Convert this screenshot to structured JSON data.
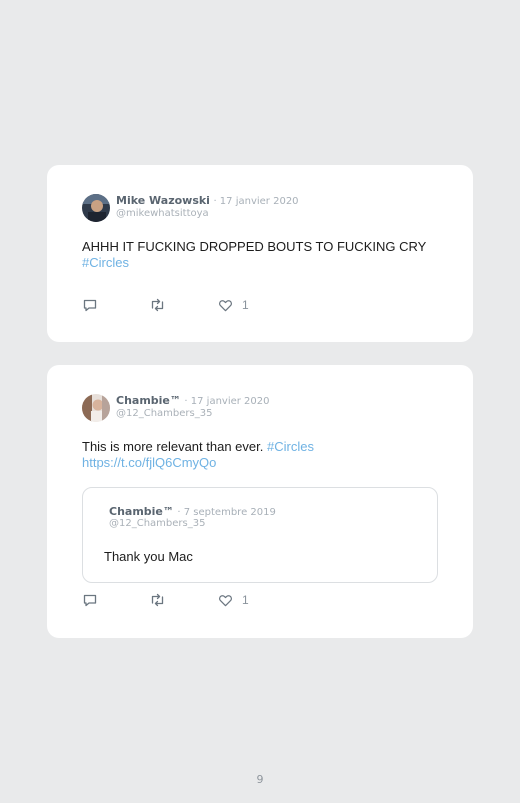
{
  "tweets": [
    {
      "author": "Mike Wazowski",
      "date": "· 17 janvier 2020",
      "handle": "@mikewhatsittoya",
      "text": "AHHH IT FUCKING DROPPED BOUTS TO FUCKING CRY",
      "hashtag": "#Circles",
      "likes": "1",
      "icons": {
        "reply": "reply-icon",
        "retweet": "retweet-icon",
        "like": "heart-icon"
      }
    },
    {
      "author": "Chambie™",
      "date": "· 17 janvier 2020",
      "handle": "@12_Chambers_35",
      "text": "This is more relevant than ever.",
      "hashtag": "#Circles",
      "url": "https://t.co/fjlQ6CmyQo",
      "likes": "1",
      "quoted": {
        "author": "Chambie™",
        "date": "· 7 septembre 2019",
        "handle": "@12_Chambers_35",
        "text": "Thank you Mac"
      }
    }
  ],
  "page_number": "9",
  "colors": {
    "background": "#e9eaeb",
    "card": "#ffffff",
    "link": "#6fb2e3",
    "icon": "#6b7680"
  }
}
